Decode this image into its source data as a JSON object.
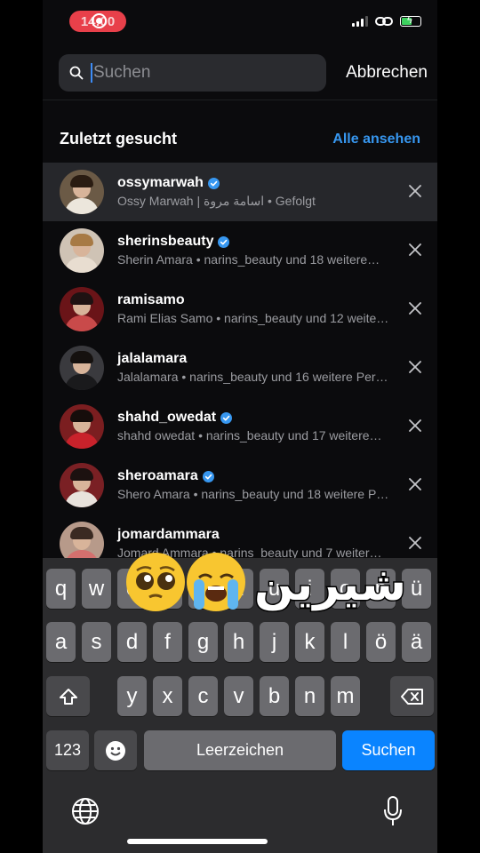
{
  "status_bar": {
    "time": "14:00"
  },
  "search": {
    "placeholder": "Suchen",
    "value": "",
    "cancel_label": "Abbrechen"
  },
  "recent": {
    "title": "Zuletzt gesucht",
    "see_all_label": "Alle ansehen"
  },
  "items": [
    {
      "username": "ossymarwah",
      "verified": true,
      "subtitle": "Ossy Marwah | اسامة مروة • Gefolgt",
      "active": true
    },
    {
      "username": "sherinsbeauty",
      "verified": true,
      "subtitle": "Sherin Amara • narins_beauty und 18 weitere…",
      "active": false
    },
    {
      "username": "ramisamo",
      "verified": false,
      "subtitle": "Rami Elias Samo • narins_beauty und 12 weite…",
      "active": false
    },
    {
      "username": "jalalamara",
      "verified": false,
      "subtitle": "Jalalamara • narins_beauty und 16 weitere Per…",
      "active": false
    },
    {
      "username": "shahd_owedat",
      "verified": true,
      "subtitle": "shahd owedat • narins_beauty und 17 weitere…",
      "active": false
    },
    {
      "username": "sheroamara",
      "verified": true,
      "subtitle": "Shero Amara • narins_beauty und 18 weitere P…",
      "active": false
    },
    {
      "username": "jomardammara",
      "verified": false,
      "subtitle": "Jomard Ammara • narins_beauty und 7 weiter…",
      "active": false
    }
  ],
  "keyboard": {
    "row1": [
      "q",
      "w",
      "e",
      "r",
      "t",
      "z",
      "u",
      "i",
      "o",
      "p",
      "ü"
    ],
    "row2": [
      "a",
      "s",
      "d",
      "f",
      "g",
      "h",
      "j",
      "k",
      "l",
      "ö",
      "ä"
    ],
    "row3": [
      "y",
      "x",
      "c",
      "v",
      "b",
      "n",
      "m"
    ],
    "numbers_label": "123",
    "space_label": "Leerzeichen",
    "search_label": "Suchen"
  },
  "overlay": {
    "text": "شيرين"
  },
  "colors": {
    "accent": "#3797f0",
    "keyboard_blue": "#0a84ff",
    "recording": "#e8404a"
  }
}
